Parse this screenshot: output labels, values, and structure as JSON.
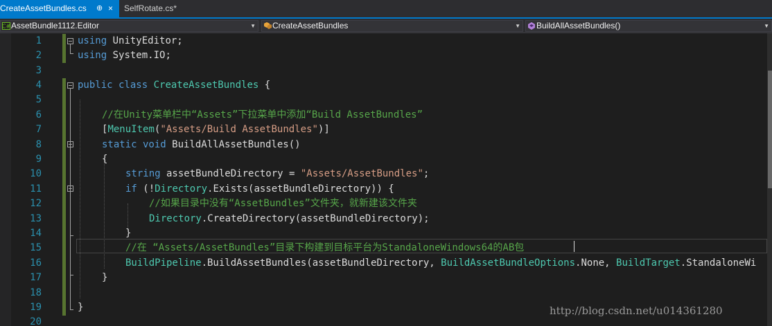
{
  "tabs": [
    {
      "label": "CreateAssetBundles.cs",
      "pin": "⊕",
      "close": "×",
      "active": true
    },
    {
      "label": "SelfRotate.cs*",
      "active": false
    }
  ],
  "nav": {
    "project": "AssetBundle1112.Editor",
    "class_name": "CreateAssetBundles",
    "member": "BuildAllAssetBundles()"
  },
  "line_numbers": [
    "1",
    "2",
    "3",
    "4",
    "5",
    "6",
    "7",
    "8",
    "9",
    "10",
    "11",
    "12",
    "13",
    "14",
    "15",
    "16",
    "17",
    "18",
    "19",
    "20"
  ],
  "code": {
    "l1_kw": "using",
    "l1_rest": " UnityEditor;",
    "l2_kw": "using",
    "l2_rest": " System.IO;",
    "l4_kw": "public class",
    "l4_type": " CreateAssetBundles",
    "l4_rest": " {",
    "l6_comment": "//在Unity菜单栏中“Assets”下拉菜单中添加“Build AssetBundles”",
    "l7_open": "[",
    "l7_attr": "MenuItem",
    "l7_paren": "(",
    "l7_str": "\"Assets/Build AssetBundles\"",
    "l7_close": ")]",
    "l8_kw": "static void",
    "l8_rest": " BuildAllAssetBundles()",
    "l9_text": "{",
    "l10_kw": "string",
    "l10_mid": " assetBundleDirectory = ",
    "l10_str": "\"Assets/AssetBundles\"",
    "l10_end": ";",
    "l11_kw": "if",
    "l11_a": " (!",
    "l11_type": "Directory",
    "l11_b": ".Exists(assetBundleDirectory)) {",
    "l12_comment": "//如果目录中没有“AssetBundles”文件夹，就新建该文件夹",
    "l13_type": "Directory",
    "l13_rest": ".CreateDirectory(assetBundleDirectory);",
    "l14_text": "}",
    "l15_comment": "//在 “Assets/AssetBundles”目录下构建到目标平台为StandaloneWindows64的AB包",
    "l16_type1": "BuildPipeline",
    "l16_a": ".BuildAssetBundles(assetBundleDirectory, ",
    "l16_type2": "BuildAssetBundleOptions",
    "l16_b": ".None, ",
    "l16_type3": "BuildTarget",
    "l16_c": ".StandaloneWi",
    "l17_text": "}",
    "l19_text": "}"
  },
  "watermark": "http://blog.csdn.net/u014361280"
}
